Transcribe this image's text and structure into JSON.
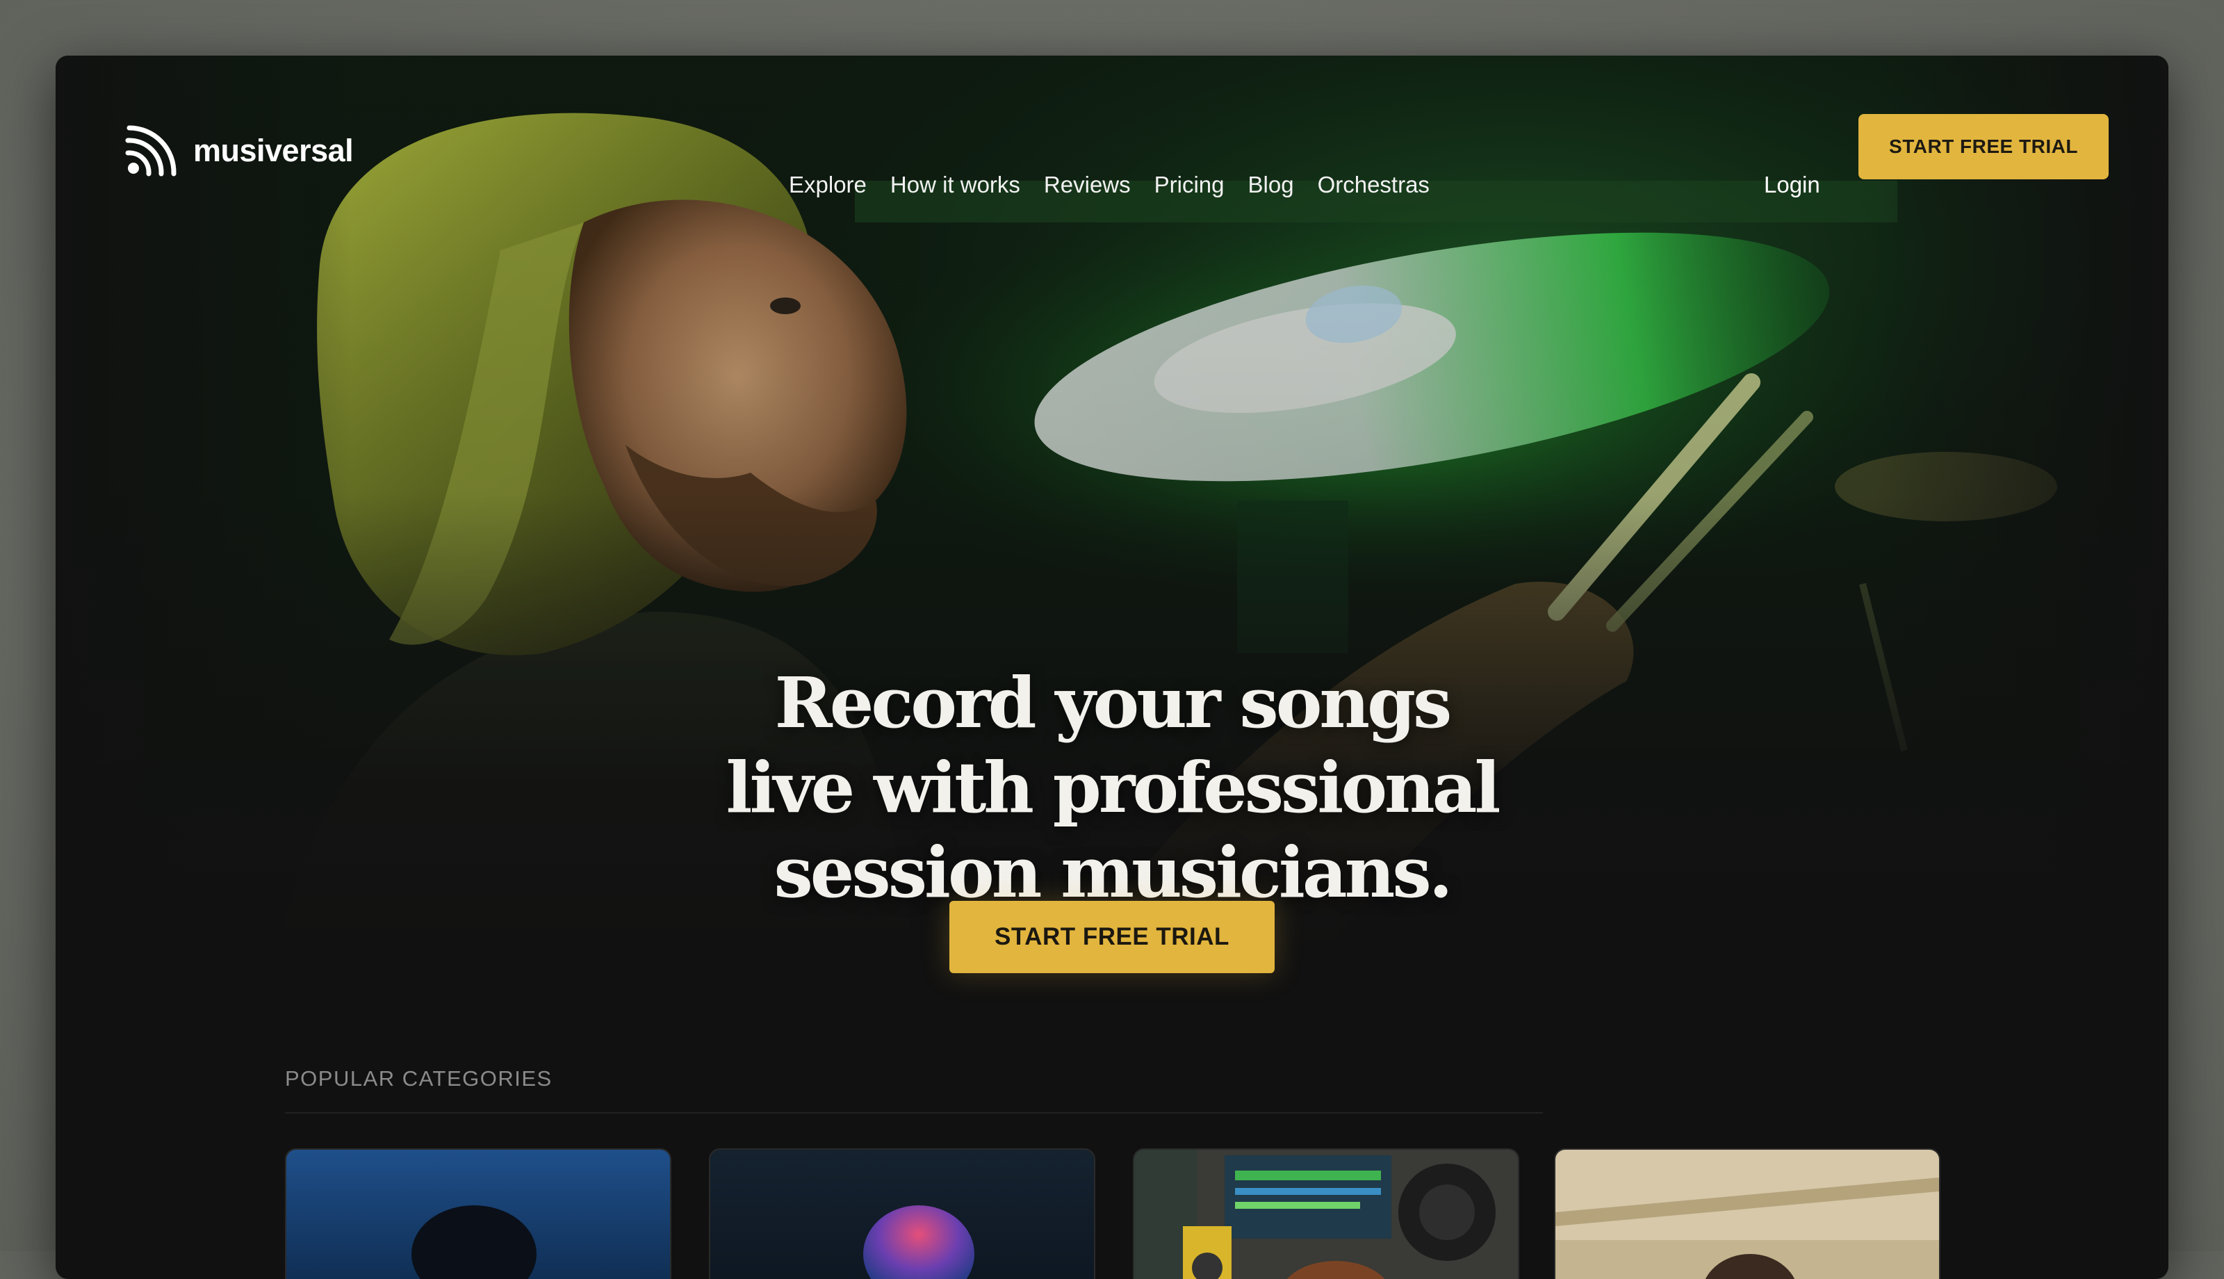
{
  "brand": {
    "name": "musiversal",
    "logo_icon": "sound-wave-logo-icon"
  },
  "nav": {
    "links": [
      "Explore",
      "How it works",
      "Reviews",
      "Pricing",
      "Blog",
      "Orchestras"
    ],
    "login_label": "Login",
    "cta_label": "START FREE TRIAL"
  },
  "hero": {
    "headline_lines": [
      "Record your songs",
      "live with professional",
      "session musicians."
    ],
    "cta_label": "START FREE TRIAL",
    "image_icon": "drummer-photo"
  },
  "categories": {
    "heading": "POPULAR CATEGORIES",
    "cards": [
      {
        "image_icon": "singer-photo"
      },
      {
        "image_icon": "performer-photo"
      },
      {
        "image_icon": "studio-producer-photo"
      },
      {
        "image_icon": "musician-photo"
      }
    ]
  },
  "colors": {
    "accent": "#e2b53e",
    "background": "#111111",
    "text": "#ffffff"
  }
}
